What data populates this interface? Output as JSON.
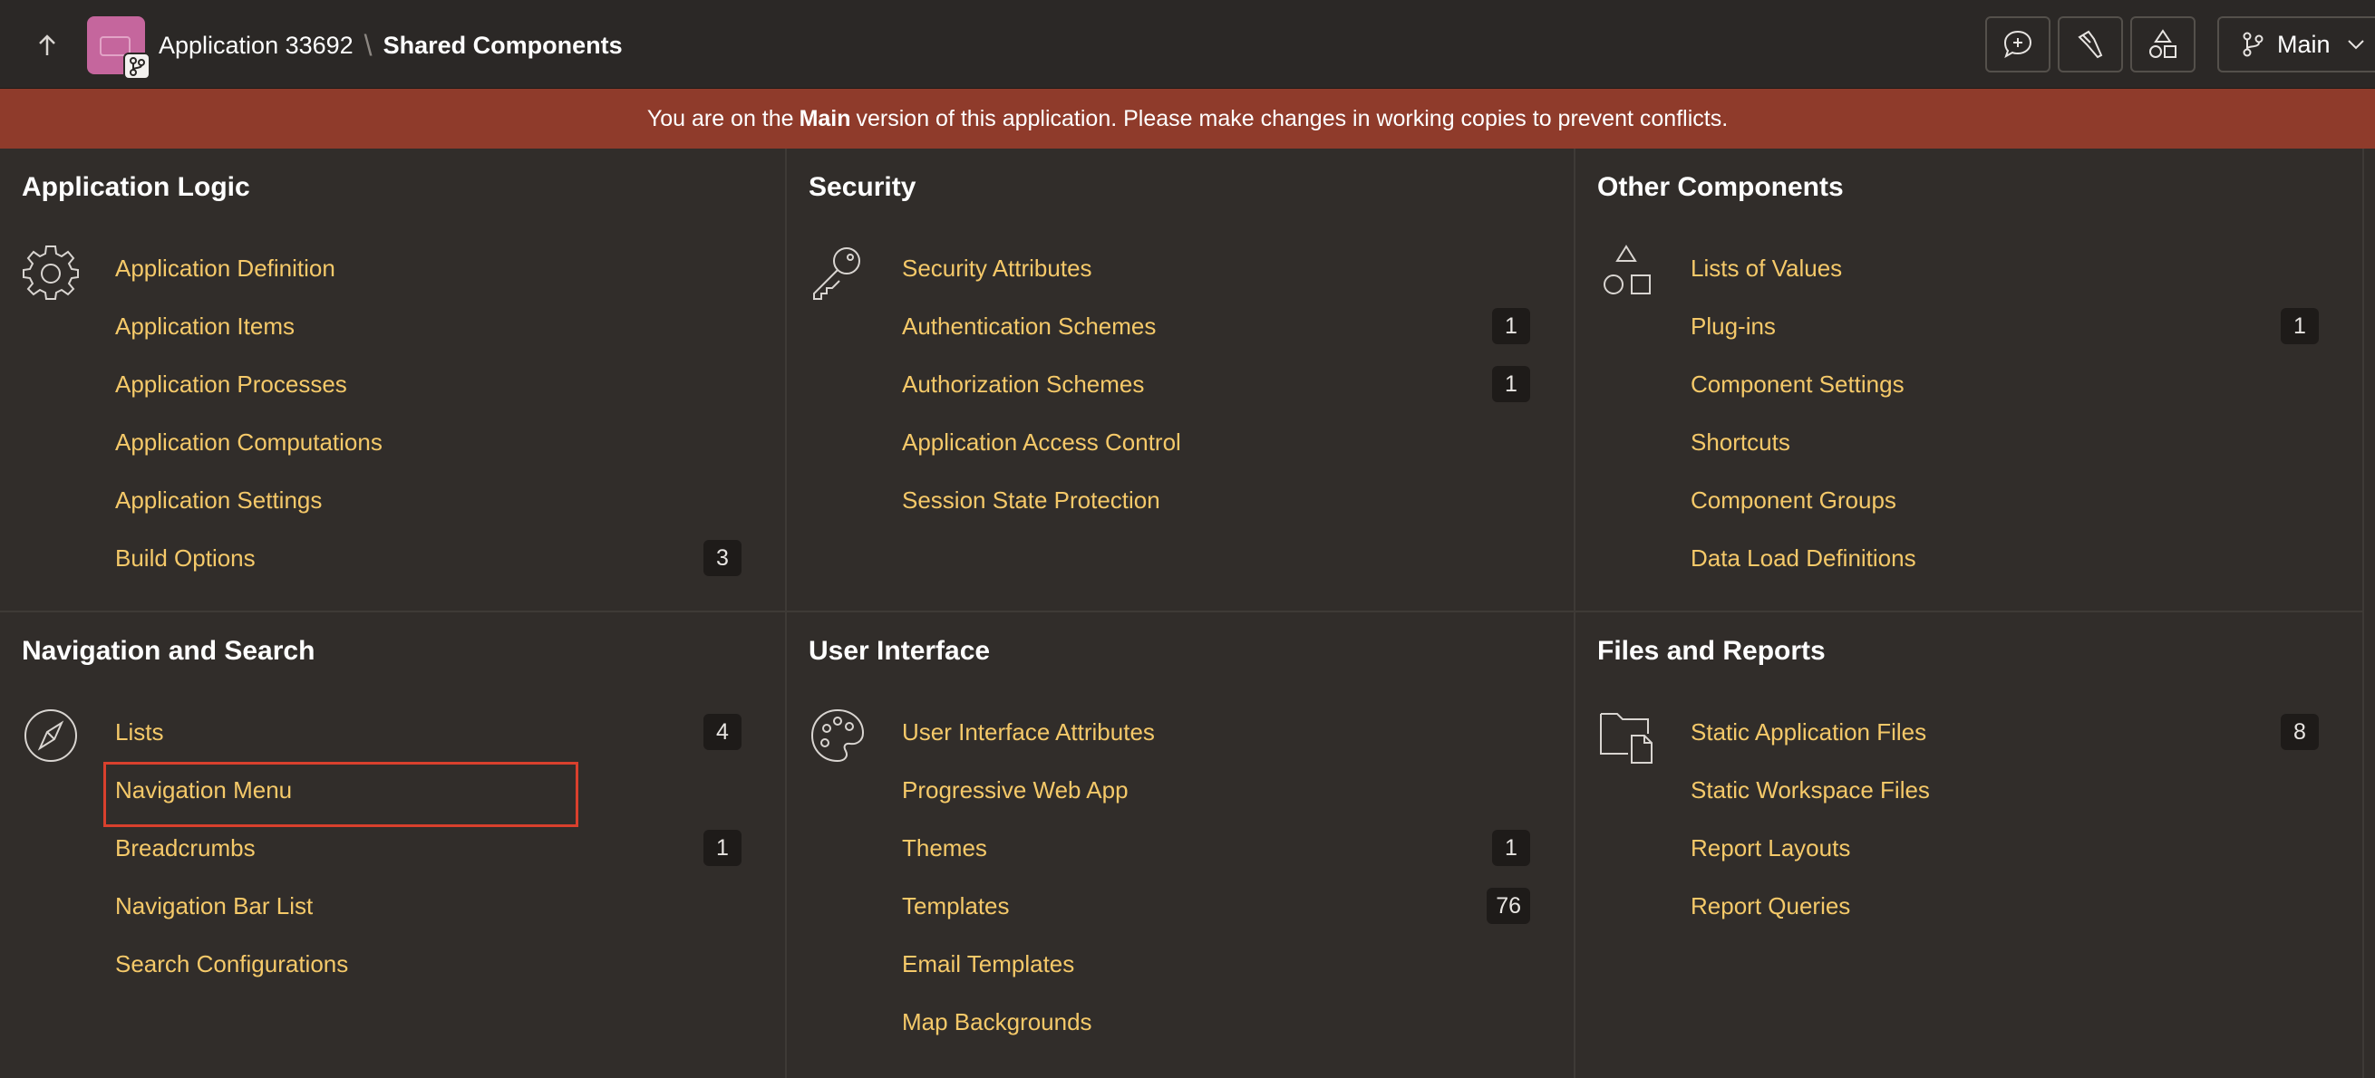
{
  "header": {
    "app_name": "Application 33692",
    "separator": "\\",
    "page_title": "Shared Components",
    "branch_label": "Main"
  },
  "banner": {
    "prefix": "You are on the",
    "bold": "Main",
    "suffix": "version of this application. Please make changes in working copies to prevent conflicts."
  },
  "sections": {
    "application_logic": {
      "title": "Application Logic",
      "icon": "gear-icon",
      "items": [
        {
          "label": "Application Definition",
          "count": ""
        },
        {
          "label": "Application Items",
          "count": ""
        },
        {
          "label": "Application Processes",
          "count": ""
        },
        {
          "label": "Application Computations",
          "count": ""
        },
        {
          "label": "Application Settings",
          "count": ""
        },
        {
          "label": "Build Options",
          "count": "3"
        }
      ]
    },
    "security": {
      "title": "Security",
      "icon": "key-icon",
      "items": [
        {
          "label": "Security Attributes",
          "count": ""
        },
        {
          "label": "Authentication Schemes",
          "count": "1"
        },
        {
          "label": "Authorization Schemes",
          "count": "1"
        },
        {
          "label": "Application Access Control",
          "count": ""
        },
        {
          "label": "Session State Protection",
          "count": ""
        }
      ]
    },
    "other_components": {
      "title": "Other Components",
      "icon": "shapes-icon",
      "items": [
        {
          "label": "Lists of Values",
          "count": ""
        },
        {
          "label": "Plug-ins",
          "count": "1"
        },
        {
          "label": "Component Settings",
          "count": ""
        },
        {
          "label": "Shortcuts",
          "count": ""
        },
        {
          "label": "Component Groups",
          "count": ""
        },
        {
          "label": "Data Load Definitions",
          "count": ""
        }
      ]
    },
    "navigation_search": {
      "title": "Navigation and Search",
      "icon": "compass-icon",
      "items": [
        {
          "label": "Lists",
          "count": "4"
        },
        {
          "label": "Navigation Menu",
          "count": ""
        },
        {
          "label": "Breadcrumbs",
          "count": "1"
        },
        {
          "label": "Navigation Bar List",
          "count": ""
        },
        {
          "label": "Search Configurations",
          "count": ""
        }
      ]
    },
    "user_interface": {
      "title": "User Interface",
      "icon": "palette-icon",
      "items": [
        {
          "label": "User Interface Attributes",
          "count": ""
        },
        {
          "label": "Progressive Web App",
          "count": ""
        },
        {
          "label": "Themes",
          "count": "1"
        },
        {
          "label": "Templates",
          "count": "76"
        },
        {
          "label": "Email Templates",
          "count": ""
        },
        {
          "label": "Map Backgrounds",
          "count": ""
        }
      ]
    },
    "files_reports": {
      "title": "Files and Reports",
      "icon": "folder-file-icon",
      "items": [
        {
          "label": "Static Application Files",
          "count": "8"
        },
        {
          "label": "Static Workspace Files",
          "count": ""
        },
        {
          "label": "Report Layouts",
          "count": ""
        },
        {
          "label": "Report Queries",
          "count": ""
        }
      ]
    }
  }
}
